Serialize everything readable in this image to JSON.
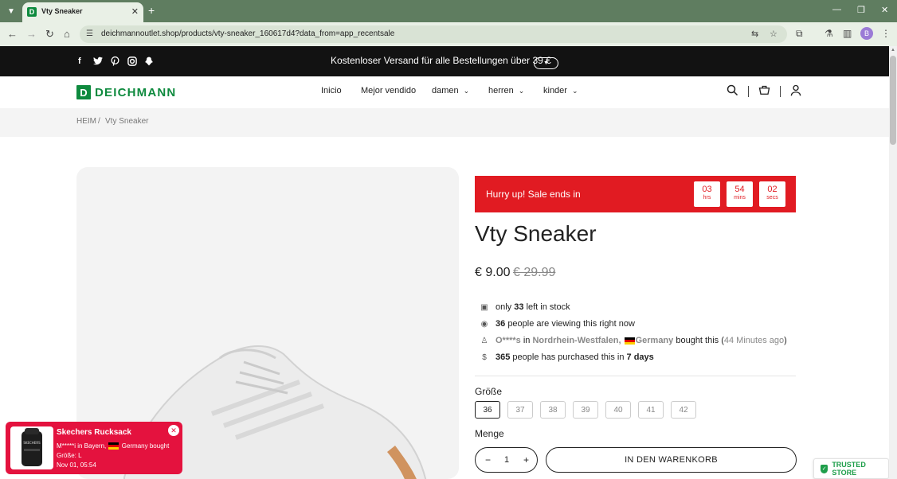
{
  "browser": {
    "tab_title": "Vty Sneaker",
    "tab_favicon": "D",
    "url": "deichmannoutlet.shop/products/vty-sneaker_160617d4?data_from=app_recentsale",
    "profile_initial": "B"
  },
  "announcement": {
    "text": "Kostenloser Versand für alle Bestellungen über 39 €",
    "social_icons": [
      "facebook-icon",
      "twitter-icon",
      "pinterest-icon",
      "instagram-icon",
      "snapchat-icon"
    ]
  },
  "header": {
    "logo_letter": "D",
    "logo_word": "DEICHMANN",
    "nav": [
      {
        "label": "Inicio"
      },
      {
        "label": "Mejor vendido"
      },
      {
        "label": "damen"
      },
      {
        "label": "herren"
      },
      {
        "label": "kinder"
      }
    ]
  },
  "breadcrumb": {
    "home": "HEIM",
    "separator": "/",
    "current": "Vty Sneaker"
  },
  "countdown": {
    "text": "Hurry up!  Sale ends in",
    "hours": "03",
    "hours_unit": "hrs",
    "minutes": "54",
    "minutes_unit": "mins",
    "seconds": "02",
    "seconds_unit": "secs"
  },
  "product": {
    "title": "Vty Sneaker",
    "price": "€ 9.00",
    "compare_price": "€ 29.99"
  },
  "info": {
    "stock_prefix": "only",
    "stock_count": "33",
    "stock_suffix": "left in stock",
    "viewers_count": "36",
    "viewers_suffix": "people are viewing this right now",
    "buyer_name": "O****s",
    "buyer_in": "in",
    "buyer_region": "Nordrhein-Westfalen,",
    "buyer_country": "Germany",
    "buyer_action": "bought this (",
    "buyer_time": "44 Minutes ago",
    "buyer_close": ")",
    "purchased_count": "365",
    "purchased_mid": "people has purchased this in",
    "purchased_days": "7 days"
  },
  "size": {
    "label": "Größe",
    "options": [
      "36",
      "37",
      "38",
      "39",
      "40",
      "41",
      "42"
    ],
    "selected": "36"
  },
  "quantity": {
    "label": "Menge",
    "value": "1",
    "minus": "−",
    "plus": "+"
  },
  "cart_button": "IN DEN WARENKORB",
  "popup": {
    "title": "Skechers Rucksack",
    "line1_prefix": "M*****i in Bayern,",
    "line1_suffix": "Germany bought",
    "line2": "Größe: L",
    "line3": "Nov 01, 05:54",
    "bag_brand": "SKECHERS"
  },
  "trusted_badge": "TRUSTED STORE",
  "colors": {
    "brand_green": "#0e8a3e",
    "sale_red": "#e11b22",
    "popup_red": "#e4123e",
    "trusted_green": "#1e9e4a"
  }
}
